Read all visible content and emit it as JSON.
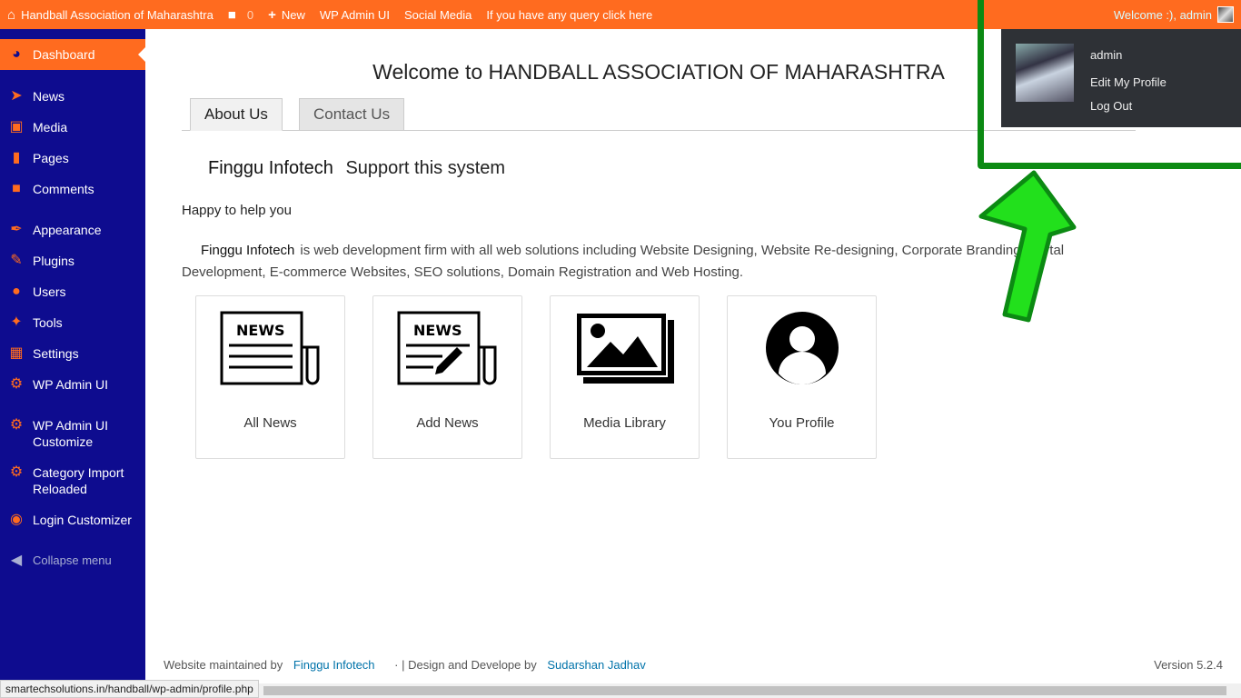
{
  "adminbar": {
    "site_name": "Handball Association of Maharashtra",
    "comments_count": "0",
    "new_label": "New",
    "wp_admin_ui_label": "WP Admin UI",
    "social_media_label": "Social Media",
    "query_label": "If you have any query click here",
    "welcome_text": "Welcome :), admin",
    "color": "#ff6b1f"
  },
  "user_dropdown": {
    "name": "admin",
    "edit_profile": "Edit My Profile",
    "logout": "Log Out"
  },
  "sidebar": {
    "color": "#0e0c8f",
    "items": [
      {
        "label": "Dashboard",
        "icon": "dashboard-icon"
      },
      {
        "label": "News",
        "icon": "pin-icon"
      },
      {
        "label": "Media",
        "icon": "media-icon"
      },
      {
        "label": "Pages",
        "icon": "pages-icon"
      },
      {
        "label": "Comments",
        "icon": "comments-icon"
      },
      {
        "label": "Appearance",
        "icon": "brush-icon"
      },
      {
        "label": "Plugins",
        "icon": "plugins-icon"
      },
      {
        "label": "Users",
        "icon": "users-icon"
      },
      {
        "label": "Tools",
        "icon": "wrench-icon"
      },
      {
        "label": "Settings",
        "icon": "settings-icon"
      },
      {
        "label": "WP Admin UI",
        "icon": "gear-icon"
      },
      {
        "label": "WP Admin UI Customize",
        "icon": "gear-icon"
      },
      {
        "label": "Category Import Reloaded",
        "icon": "gear-icon"
      },
      {
        "label": "Login Customizer",
        "icon": "eye-icon"
      },
      {
        "label": "Collapse menu",
        "icon": "collapse-icon"
      }
    ]
  },
  "main": {
    "title": "Welcome to HANDBALL ASSOCIATION OF MAHARASHTRA",
    "tabs": [
      {
        "label": "About Us"
      },
      {
        "label": "Contact Us"
      }
    ],
    "support_company": "Finggu Infotech",
    "support_label": "Support this system",
    "happy_text": "Happy to help you",
    "about_company": "Finggu Infotech",
    "about_text": "is web development firm with all web solutions including Website Designing, Website Re-designing, Corporate Branding, Portal Development, E-commerce Websites, SEO solutions, Domain Registration and Web Hosting.",
    "cards": [
      {
        "label": "All News",
        "icon": "news-icon"
      },
      {
        "label": "Add News",
        "icon": "add-news-icon"
      },
      {
        "label": "Media Library",
        "icon": "media-library-icon"
      },
      {
        "label": "You Profile",
        "icon": "profile-icon"
      }
    ]
  },
  "footer": {
    "maintained_prefix": "Website maintained by",
    "maintained_link": "Finggu Infotech",
    "design_prefix": "· | Design and Develope by",
    "design_link": "Sudarshan Jadhav",
    "version": "Version 5.2.4"
  },
  "status_url": "smartechsolutions.in/handball/wp-admin/profile.php",
  "highlight_color": "#0c8a13"
}
